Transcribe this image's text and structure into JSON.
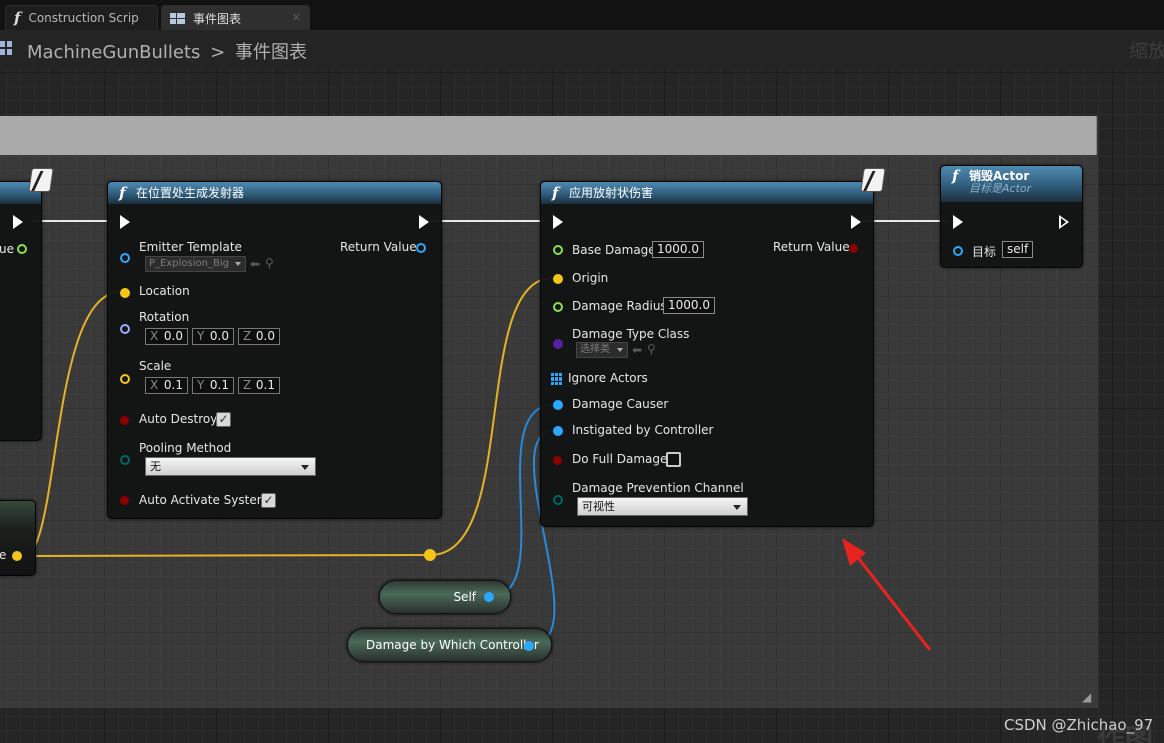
{
  "tabs": [
    {
      "label": "Construction Scrip",
      "icon": "function-icon"
    },
    {
      "label": "事件图表",
      "icon": "event-graph-icon"
    }
  ],
  "breadcrumb": {
    "blueprint": "MachineGunBullets",
    "separator": ">",
    "graph": "事件图表",
    "zoom": "缩放"
  },
  "nodes": {
    "left_partial": {
      "return_partial": "ue",
      "out_partial": "e"
    },
    "spawn_emitter": {
      "title": "在位置处生成发射器",
      "emitter_template": "Emitter Template",
      "emitter_value": "P_Explosion_Big",
      "return_value": "Return Value",
      "location": "Location",
      "rotation": "Rotation",
      "rotation_values": [
        "0.0",
        "0.0",
        "0.0"
      ],
      "scale": "Scale",
      "scale_values": [
        "0.1",
        "0.1",
        "0.1"
      ],
      "axis_labels": [
        "X",
        "Y",
        "Z"
      ],
      "auto_destroy": "Auto Destroy",
      "pooling_method": "Pooling Method",
      "pooling_value": "无",
      "auto_activate": "Auto Activate System"
    },
    "radial_damage": {
      "title": "应用放射状伤害",
      "base_damage": "Base Damage",
      "base_damage_value": "1000.0",
      "return_value": "Return Value",
      "origin": "Origin",
      "damage_radius": "Damage Radius",
      "damage_radius_value": "1000.0",
      "damage_type_class": "Damage Type Class",
      "damage_type_value": "选择类",
      "ignore_actors": "Ignore Actors",
      "damage_causer": "Damage Causer",
      "instigated_by": "Instigated by Controller",
      "do_full_damage": "Do Full Damage",
      "prevention_channel": "Damage Prevention Channel",
      "prevention_value": "可视性"
    },
    "destroy_actor": {
      "title": "销毁Actor",
      "subtitle": "目标是Actor",
      "target": "目标",
      "target_value": "self"
    }
  },
  "variables": {
    "self": "Self",
    "damage_controller": "Damage by Which Controller"
  },
  "watermark": "CSDN @Zhichao_97",
  "watermark2": "作图"
}
